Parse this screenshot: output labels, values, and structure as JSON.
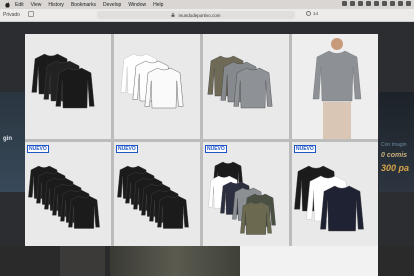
{
  "menubar": {
    "items": [
      "Edit",
      "View",
      "History",
      "Bookmarks",
      "Develop",
      "Window",
      "Help"
    ]
  },
  "toolbar": {
    "private_label": "Privado",
    "url": "mundodeportivo.com",
    "tab_count": "14"
  },
  "side_ads": {
    "left_text": "gin",
    "right_line1": "Con Imagin",
    "right_line2": "0 comis",
    "right_line3": "300 pa"
  },
  "products": [
    {
      "badge": "",
      "shirt_color": "#1b1b1b",
      "count": 3,
      "type": "stack"
    },
    {
      "badge": "",
      "shirt_color": "#ffffff",
      "count": 3,
      "type": "stack"
    },
    {
      "badge": "",
      "shirt_color": "#7a7a6a",
      "count": 3,
      "type": "stack"
    },
    {
      "badge": "",
      "shirt_color": "#8d9196",
      "count": 1,
      "type": "model"
    },
    {
      "badge": "NUEVO",
      "shirt_color": "#1b1b1b",
      "count": 6,
      "type": "stack"
    },
    {
      "badge": "NUEVO",
      "shirt_color": "#1b1b1b",
      "count": 6,
      "type": "stack"
    },
    {
      "badge": "NUEVO",
      "shirt_color": "#mix",
      "count": 6,
      "type": "stack"
    },
    {
      "badge": "NUEVO",
      "shirt_color": "#mix2",
      "count": 3,
      "type": "stack"
    }
  ]
}
